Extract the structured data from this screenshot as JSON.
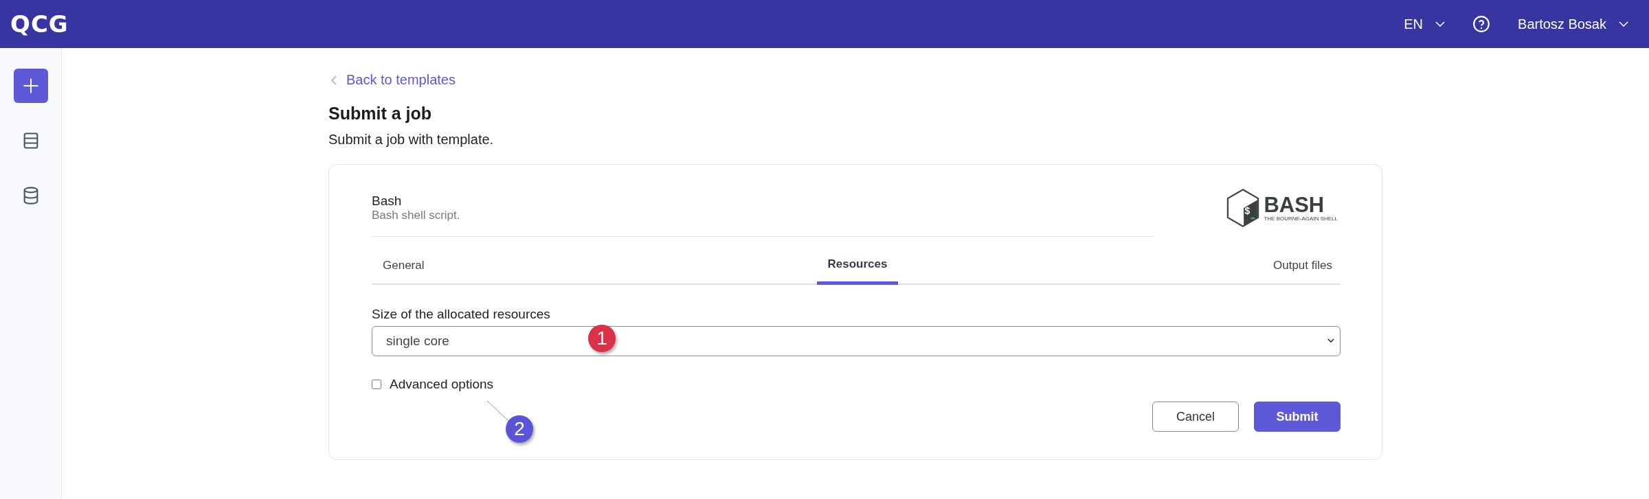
{
  "header": {
    "logo": "QCG",
    "language": "EN",
    "user": "Bartosz Bosak"
  },
  "sidebar": {
    "items": [
      {
        "kind": "add",
        "selected": true
      },
      {
        "kind": "list",
        "selected": false
      },
      {
        "kind": "database",
        "selected": false
      }
    ]
  },
  "back_link": "Back to templates",
  "title": "Submit a job",
  "subtitle": "Submit a job with template.",
  "template": {
    "name": "Bash",
    "description": "Bash shell script.",
    "logo_title": "BASH",
    "logo_tagline": "THE BOURNE-AGAIN SHELL",
    "logo_prompt": "$"
  },
  "tabs": [
    {
      "label": "General",
      "selected": false
    },
    {
      "label": "Resources",
      "selected": true
    },
    {
      "label": "Output files",
      "selected": false
    }
  ],
  "resources": {
    "label": "Size of the allocated resources",
    "value": "single core"
  },
  "advanced_options": {
    "label": "Advanced options",
    "checked": false
  },
  "buttons": [
    {
      "label": "Cancel",
      "kind": "secondary"
    },
    {
      "label": "Submit",
      "kind": "primary"
    }
  ],
  "callouts": [
    {
      "label": "1",
      "color": "#d9334a"
    },
    {
      "label": "2",
      "color": "#5a55d6"
    }
  ]
}
